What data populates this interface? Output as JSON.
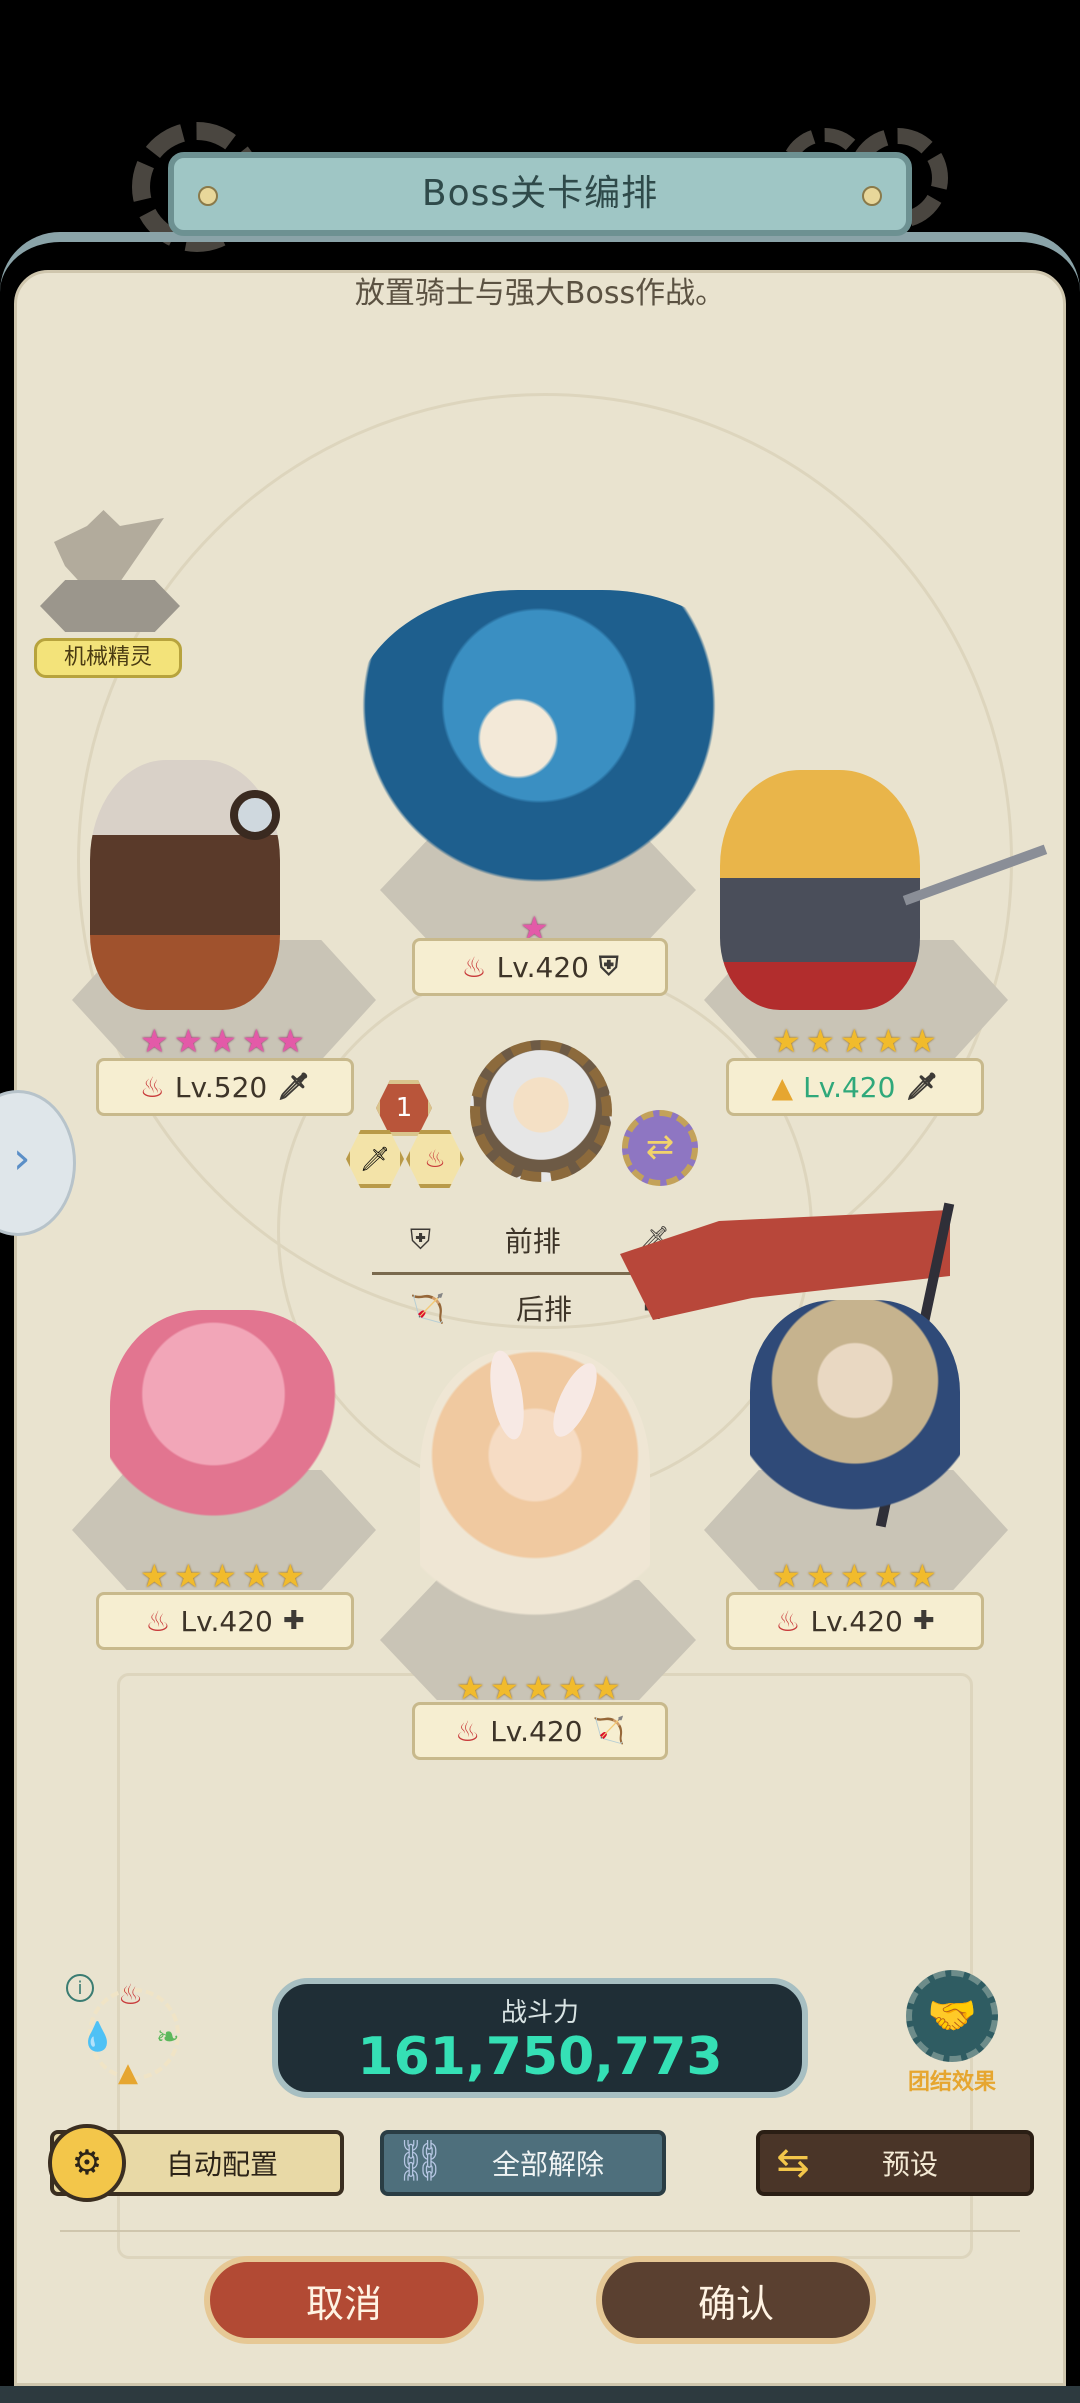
{
  "header": {
    "title": "Boss关卡编排",
    "subtitle": "放置骑士与强大Boss作战。"
  },
  "pet": {
    "label": "机械精灵"
  },
  "slots": [
    {
      "id": "raccoon",
      "level": "Lv.520",
      "stars": 5,
      "star_color": "pink",
      "element": "fire",
      "role": "sword-icon"
    },
    {
      "id": "dragon-girl",
      "level": "Lv.420",
      "stars": 1,
      "star_color": "pink",
      "element": "fire",
      "role": "shield-icon"
    },
    {
      "id": "blonde-knight",
      "level": "Lv.420",
      "stars": 5,
      "star_color": "gold",
      "element": "earth",
      "role": "sword-icon"
    },
    {
      "id": "fairy",
      "level": "Lv.420",
      "stars": 5,
      "star_color": "gold",
      "element": "fire",
      "role": "cross-icon"
    },
    {
      "id": "bunny-girl",
      "level": "Lv.420",
      "stars": 5,
      "star_color": "gold",
      "element": "fire",
      "role": "bow-icon"
    },
    {
      "id": "flag-girl",
      "level": "Lv.420",
      "stars": 5,
      "star_color": "gold",
      "element": "fire",
      "role": "cross-icon"
    }
  ],
  "leader": {
    "badge_number": "1"
  },
  "rows": {
    "front_label": "前排",
    "back_label": "后排"
  },
  "power": {
    "label": "战斗力",
    "value": "161,750,773"
  },
  "team_effect": {
    "label": "团结效果"
  },
  "buttons": {
    "auto": "自动配置",
    "clear": "全部解除",
    "preset": "预设",
    "cancel": "取消",
    "confirm": "确认"
  },
  "colors": {
    "power_text": "#35e0b5",
    "earth_level": "#2fa87a"
  }
}
